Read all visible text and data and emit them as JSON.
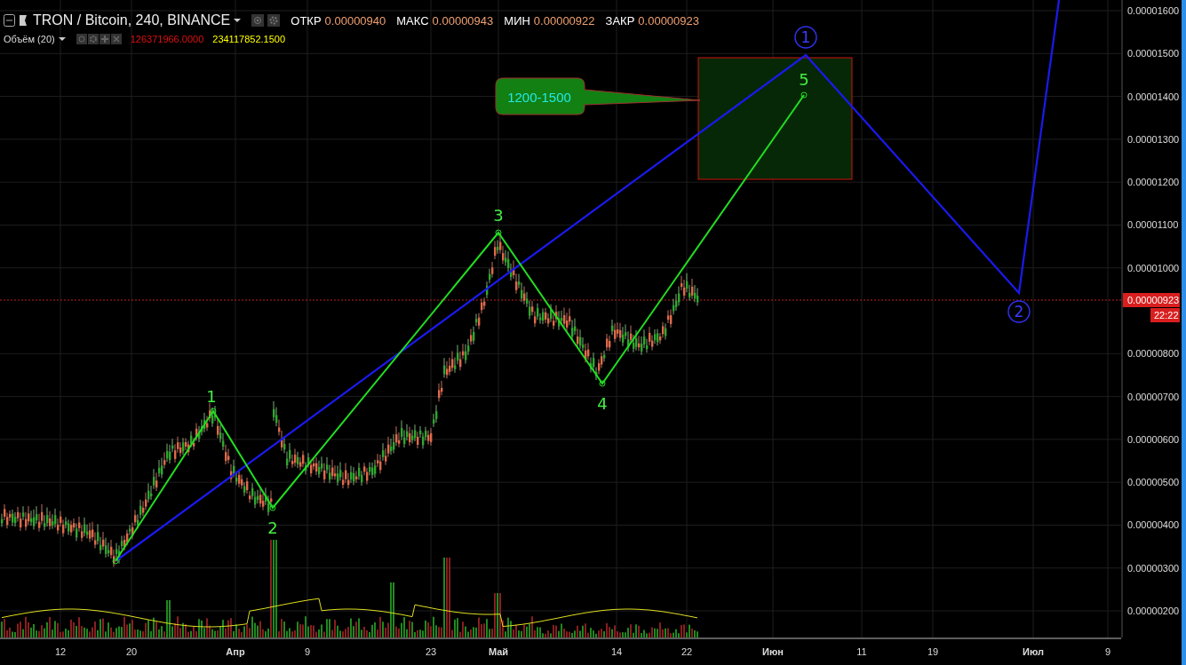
{
  "header": {
    "symbol": "TRON / Bitcoin, 240, BINANCE",
    "ohlc": [
      {
        "label": "ОТКР",
        "value": "0.00000940"
      },
      {
        "label": "МАКС",
        "value": "0.00000943"
      },
      {
        "label": "МИН",
        "value": "0.00000922"
      },
      {
        "label": "ЗАКР",
        "value": "0.00000923"
      }
    ]
  },
  "volume_legend": {
    "title": "Объём (20)",
    "values": [
      {
        "text": "126371966.0000",
        "color": "#e01010"
      },
      {
        "text": "234117852.1500",
        "color": "#ffff00"
      }
    ]
  },
  "annotations": {
    "target_callout": "1200-1500",
    "wave_labels": [
      "1",
      "2",
      "3",
      "4",
      "5"
    ],
    "circled_labels": [
      "1",
      "2"
    ]
  },
  "price_axis": {
    "labels": [
      "0.00001600",
      "0.00001500",
      "0.00001400",
      "0.00001300",
      "0.00001200",
      "0.00001100",
      "0.00001000",
      "0.00000800",
      "0.00000700",
      "0.00000600",
      "0.00000500",
      "0.00000400",
      "0.00000300",
      "0.00000200"
    ],
    "last_price": "0.00000923",
    "countdown": "22:22"
  },
  "time_axis": {
    "labels": [
      {
        "text": "12",
        "major": false
      },
      {
        "text": "20",
        "major": false
      },
      {
        "text": "Апр",
        "major": true
      },
      {
        "text": "9",
        "major": false
      },
      {
        "text": "23",
        "major": false
      },
      {
        "text": "Май",
        "major": true
      },
      {
        "text": "14",
        "major": false
      },
      {
        "text": "22",
        "major": false
      },
      {
        "text": "Июн",
        "major": true
      },
      {
        "text": "11",
        "major": false
      },
      {
        "text": "19",
        "major": false
      },
      {
        "text": "Июл",
        "major": true
      },
      {
        "text": "9",
        "major": false
      }
    ]
  }
}
